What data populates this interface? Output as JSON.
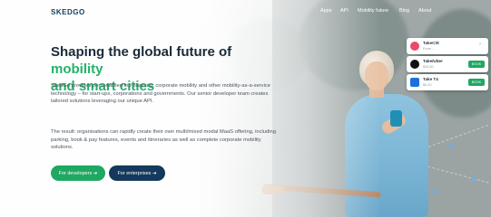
{
  "brand": {
    "logo": "SKEDGO",
    "accent": "#24b26b",
    "navy": "#14395c"
  },
  "nav": {
    "items": [
      "Apps",
      "API",
      "Mobility future",
      "Blog",
      "About"
    ]
  },
  "hero": {
    "title_part1": "Shaping the global future of ",
    "title_highlight1": "mobility",
    "title_part2": "and smart cities",
    "paragraph1": "SkedGo provides personalised trip planning, corporate mobility and other mobility-as-a-service technology – for start-ups, corporations and governments. Our senior developer team creates tailored solutions leveraging our unique API.",
    "paragraph2": "The result: organisations can rapidly create their own multi/mixed modal MaaS offering, including parking, book & pay features, events and itineraries as well as complete corporate mobility solutions."
  },
  "buttons": {
    "developers": "For developers  ➔",
    "enterprises": "For enterprises  ➔"
  },
  "cards": [
    {
      "title": "TakeCitt",
      "subtitle": "From ...",
      "action": "›",
      "icon_color": "#e94b6a"
    },
    {
      "title": "Take/Uber",
      "subtitle": "$10.00",
      "action": "BOOK",
      "icon_color": "#111111"
    },
    {
      "title": "Take T4",
      "subtitle": "$3.20",
      "action": "BOOK",
      "icon_color": "#1d6fe0"
    }
  ]
}
